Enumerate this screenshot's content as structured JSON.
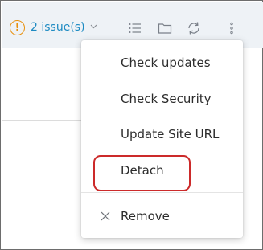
{
  "toolbar": {
    "issues_label": "2 issue(s)",
    "warning_icon_glyph": "!",
    "chevron_glyph": "⌄",
    "icons": [
      "list-icon",
      "folder-icon",
      "refresh-icon",
      "more-vertical-icon"
    ],
    "accent_color": "#1c8ac2",
    "warning_color": "#e8900c"
  },
  "menu": {
    "items": [
      {
        "label": "Check updates"
      },
      {
        "label": "Check Security"
      },
      {
        "label": "Update Site URL"
      },
      {
        "label": "Detach",
        "highlighted": true
      },
      {
        "label": "Remove",
        "icon": "close-icon"
      }
    ],
    "highlight_color": "#cc2a2a"
  }
}
